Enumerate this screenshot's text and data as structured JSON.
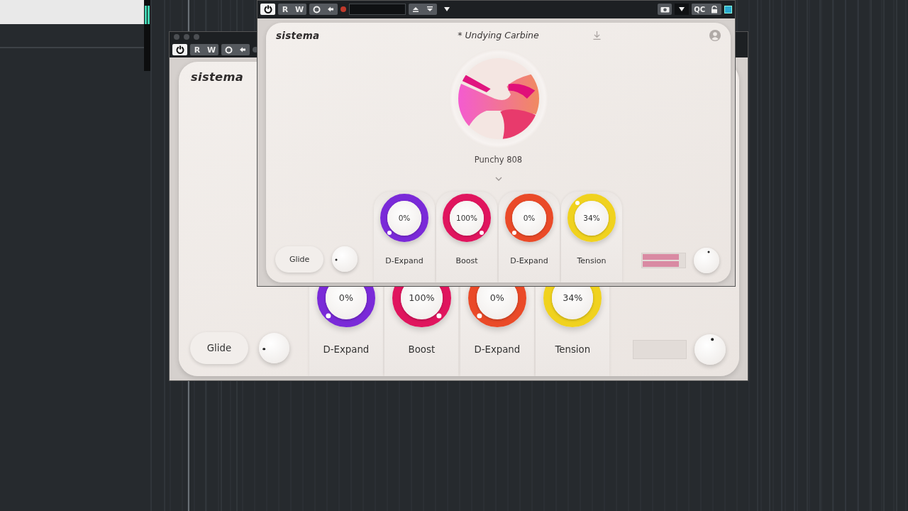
{
  "windows": [
    {
      "toolbar": {
        "kind": "compact",
        "power": {
          "on": true
        },
        "buttons": [
          {
            "label": "R",
            "on": false
          },
          {
            "label": "W",
            "on": false
          }
        ]
      },
      "plugin": {
        "logo": "sistema",
        "glide": {
          "label": "Glide"
        },
        "knobs": [
          {
            "value": "0%",
            "label": "D-Expand",
            "color": "#7a2ad8"
          },
          {
            "value": "100%",
            "label": "Boost",
            "color": "#e0155e"
          },
          {
            "value": "0%",
            "label": "D-Expand",
            "color": "#ea4a28"
          },
          {
            "value": "34%",
            "label": "Tension",
            "color": "#f0d21e"
          }
        ]
      }
    },
    {
      "toolbar": {
        "kind": "full",
        "power": {
          "on": true
        },
        "buttons": [
          {
            "label": "R",
            "on": false
          },
          {
            "label": "W",
            "on": false
          }
        ],
        "qc_label": "QC"
      },
      "plugin": {
        "logo": "sistema",
        "preset_name": "* Undying Carbine",
        "sound_name": "Punchy 808",
        "glide": {
          "label": "Glide"
        },
        "knobs": [
          {
            "value": "0%",
            "label": "D-Expand",
            "color": "#7a2ad8"
          },
          {
            "value": "100%",
            "label": "Boost",
            "color": "#e0155e"
          },
          {
            "value": "0%",
            "label": "D-Expand",
            "color": "#ea4a28"
          },
          {
            "value": "34%",
            "label": "Tension",
            "color": "#f0d21e"
          }
        ],
        "meter": {
          "bars": [
            {
              "level": 0.86
            },
            {
              "level": 0.86
            }
          ]
        }
      }
    }
  ]
}
